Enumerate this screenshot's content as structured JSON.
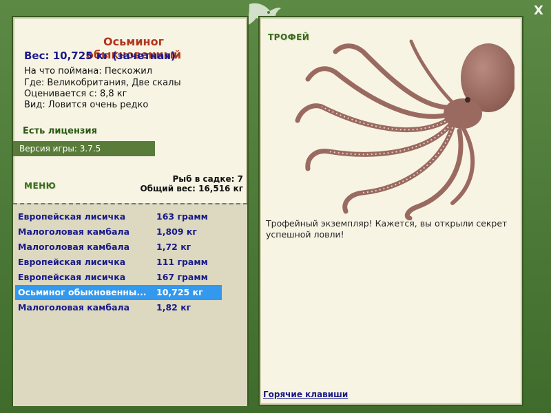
{
  "fish": {
    "title": "Осьминог обыкновенный",
    "weight": "Вес: 10,725 кг (зачетная)",
    "info": [
      "На что поймана: Пескожил",
      "Где: Великобритания, Две скалы",
      "Оценивается с: 8,8 кг",
      "Вид: Ловится очень редко"
    ]
  },
  "license": "Есть лицензия",
  "version": "Версия игры: 3.7.5",
  "menu_label": "МЕНЮ",
  "stats": {
    "cage": "Рыб в садке: 7",
    "total": "Общий вес: 16,516 кг"
  },
  "catch_list": [
    {
      "name": "Европейская лисичка",
      "value": "163 грамм",
      "selected": false
    },
    {
      "name": "Малоголовая камбала",
      "value": "1,809 кг",
      "selected": false
    },
    {
      "name": "Малоголовая камбала",
      "value": "1,72 кг",
      "selected": false
    },
    {
      "name": "Европейская лисичка",
      "value": "111 грамм",
      "selected": false
    },
    {
      "name": "Европейская лисичка",
      "value": "167 грамм",
      "selected": false
    },
    {
      "name": "Осьминог обыкновенны...",
      "value": "10,725 кг",
      "selected": true
    },
    {
      "name": "Малоголовая камбала",
      "value": "1,82 кг",
      "selected": false
    }
  ],
  "trophy": {
    "label": "ТРОФЕЙ",
    "text": "Трофейный экземпляр! Кажется, вы открыли секрет успешной ловли!",
    "hotkeys": "Горячие клавиши"
  },
  "close_label": "X",
  "colors": {
    "frame": "#4f7a3a",
    "panel": "#f7f4e4",
    "title": "#b3351a",
    "link": "#1a1a8a",
    "selected": "#3399ee"
  }
}
